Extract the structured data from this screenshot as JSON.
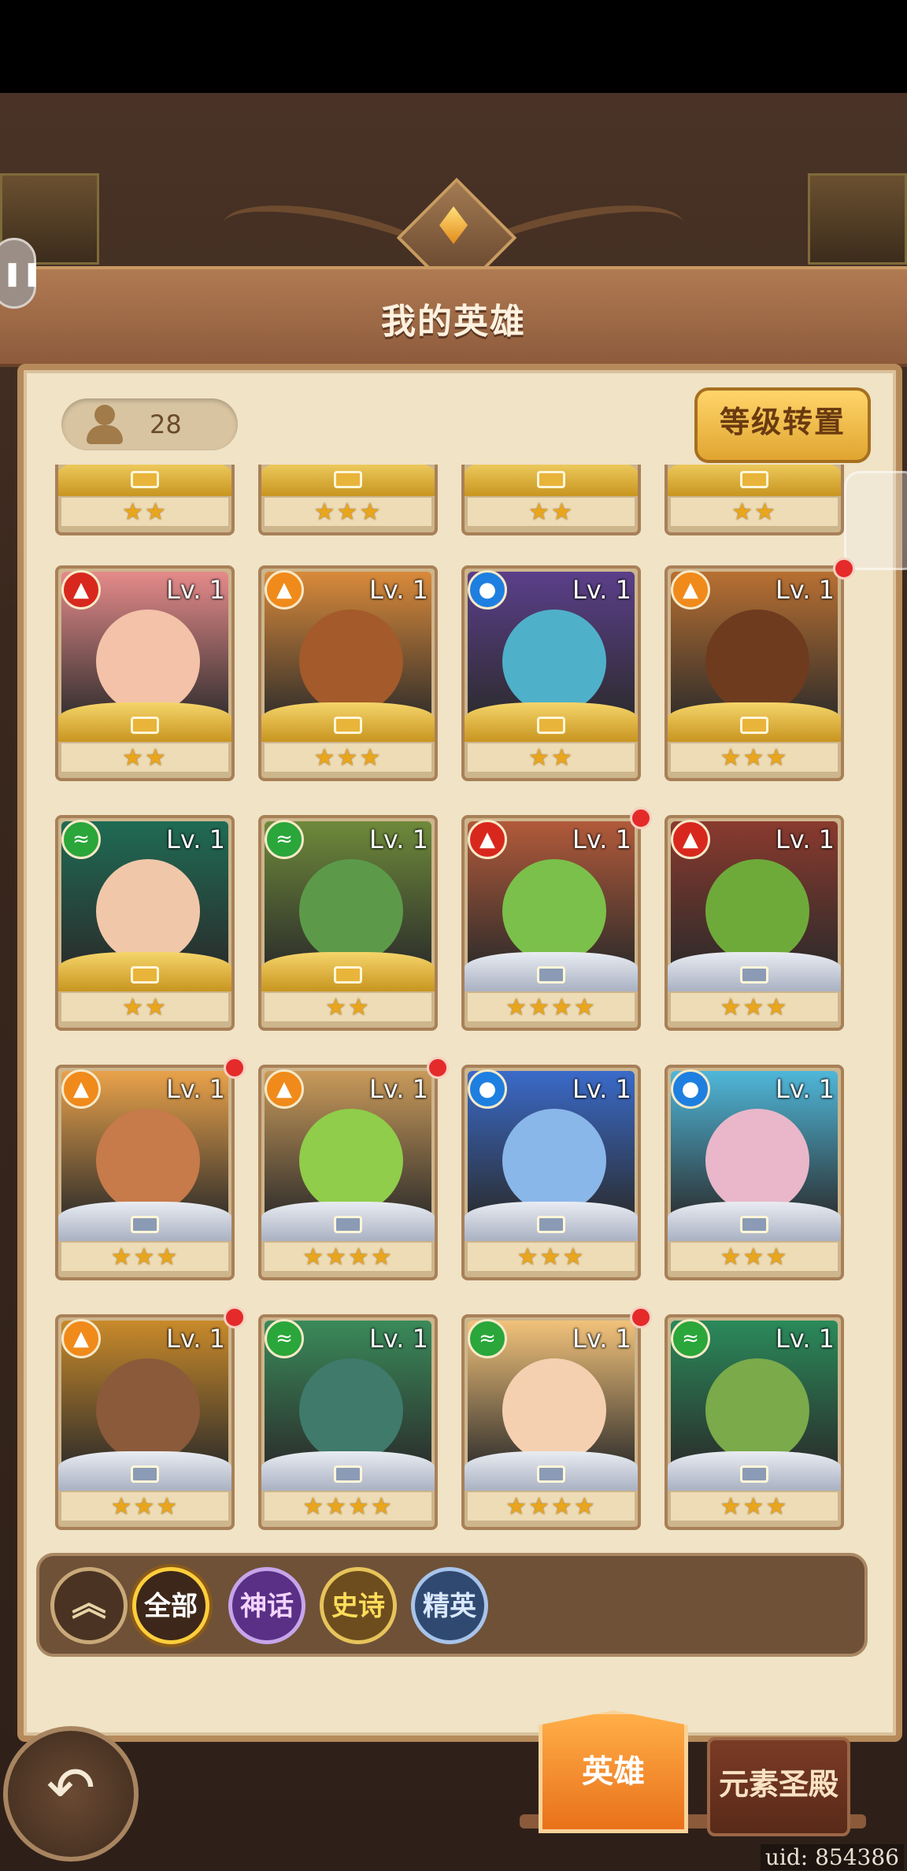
{
  "header": {
    "title": "我的英雄"
  },
  "hero_count": "28",
  "convert_button_label": "等级转置",
  "level_label": "Lv. 1",
  "top_row_stars": [
    "★★",
    "★★★",
    "★★",
    "★★"
  ],
  "heroes": [
    {
      "element": "fire",
      "stars": "★★",
      "frame": "gold",
      "dot": false,
      "bg": "#e58a8a",
      "face": "#f3c2a8"
    },
    {
      "element": "light",
      "stars": "★★★",
      "frame": "gold",
      "dot": false,
      "bg": "#d98a3a",
      "face": "#a45a2a"
    },
    {
      "element": "water",
      "stars": "★★",
      "frame": "gold",
      "dot": false,
      "bg": "#5b3f8a",
      "face": "#4fb0c9"
    },
    {
      "element": "light",
      "stars": "★★★",
      "frame": "gold",
      "dot": true,
      "bg": "#b87032",
      "face": "#6e3b1f"
    },
    {
      "element": "wind",
      "stars": "★★",
      "frame": "gold",
      "dot": false,
      "bg": "#1f6b54",
      "face": "#f1c7a9"
    },
    {
      "element": "wind",
      "stars": "★★",
      "frame": "gold",
      "dot": false,
      "bg": "#6e8a3a",
      "face": "#5c9a4a"
    },
    {
      "element": "fire",
      "stars": "★★★★",
      "frame": "silver",
      "dot": true,
      "bg": "#b25a3a",
      "face": "#7bc04a"
    },
    {
      "element": "fire",
      "stars": "★★★",
      "frame": "silver",
      "dot": false,
      "bg": "#8a3a2e",
      "face": "#6eaa3a"
    },
    {
      "element": "light",
      "stars": "★★★",
      "frame": "silver",
      "dot": true,
      "bg": "#e9a24a",
      "face": "#c77a4a"
    },
    {
      "element": "light",
      "stars": "★★★★",
      "frame": "silver",
      "dot": true,
      "bg": "#c99a5a",
      "face": "#8fcd4a"
    },
    {
      "element": "water",
      "stars": "★★★",
      "frame": "silver",
      "dot": false,
      "bg": "#3a6ac9",
      "face": "#8ab7e9"
    },
    {
      "element": "water",
      "stars": "★★★",
      "frame": "silver",
      "dot": false,
      "bg": "#4fb7d9",
      "face": "#e9b7c9"
    },
    {
      "element": "light",
      "stars": "★★★",
      "frame": "silver",
      "dot": true,
      "bg": "#c98a2a",
      "face": "#8a5a3a"
    },
    {
      "element": "wind",
      "stars": "★★★★",
      "frame": "silver",
      "dot": false,
      "bg": "#3a8a5a",
      "face": "#3f7a6a"
    },
    {
      "element": "wind",
      "stars": "★★★★",
      "frame": "silver",
      "dot": true,
      "bg": "#f2c27a",
      "face": "#f5d0b0"
    },
    {
      "element": "wind",
      "stars": "★★★",
      "frame": "silver",
      "dot": false,
      "bg": "#2a8a5a",
      "face": "#7aaa4a"
    }
  ],
  "filters": {
    "all": "全部",
    "myth": "神话",
    "epic": "史诗",
    "elite": "精英"
  },
  "tabs": {
    "hero": "英雄",
    "temple": "元素圣殿"
  },
  "uid": "uid: 854386",
  "element_colors": {
    "fire": "#d8281e",
    "light": "#f08a1a",
    "water": "#1e7fe0",
    "wind": "#2aa63a"
  },
  "element_icons": {
    "fire": "▲",
    "light": "▲",
    "water": "●",
    "wind": "≈"
  }
}
